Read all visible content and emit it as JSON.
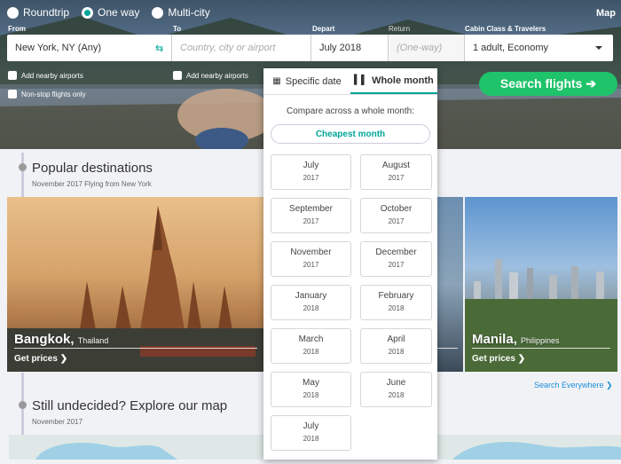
{
  "header": {
    "trip_types": [
      {
        "label": "Roundtrip",
        "selected": false
      },
      {
        "label": "One way",
        "selected": true
      },
      {
        "label": "Multi-city",
        "selected": false
      }
    ],
    "map_link": "Map",
    "labels": {
      "from": "From",
      "to": "To",
      "depart": "Depart",
      "return": "Return",
      "cabin": "Cabin Class & Travelers"
    },
    "from_value": "New York, NY (Any)",
    "to_placeholder": "Country, city or airport",
    "depart_value": "July 2018",
    "return_placeholder": "(One-way)",
    "cabin_value": "1 adult, Economy",
    "nearby_from": "Add nearby airports",
    "nearby_to": "Add nearby airports",
    "nonstop": "Non-stop flights only",
    "search_button": "Search flights ➔"
  },
  "popular": {
    "title": "Popular destinations",
    "subtitle": "November 2017    Flying from New York"
  },
  "cards": [
    {
      "city": "Bangkok",
      "country": "Thailand",
      "link": "Get prices ❯"
    },
    {
      "city": "",
      "country": "",
      "link": ""
    },
    {
      "city": "Manila",
      "country": "Philippines",
      "link": "Get prices ❯"
    }
  ],
  "search_everywhere": "Search Everywhere ❯",
  "undecided": {
    "title": "Still undecided? Explore our map",
    "subtitle": "November 2017"
  },
  "popup": {
    "tabs": [
      {
        "label": "Specific date",
        "active": false
      },
      {
        "label": "Whole month",
        "active": true
      }
    ],
    "compare_text": "Compare across a whole month:",
    "cheapest_button": "Cheapest month",
    "months": [
      {
        "month": "July",
        "year": "2017"
      },
      {
        "month": "August",
        "year": "2017"
      },
      {
        "month": "September",
        "year": "2017"
      },
      {
        "month": "October",
        "year": "2017"
      },
      {
        "month": "November",
        "year": "2017"
      },
      {
        "month": "December",
        "year": "2017"
      },
      {
        "month": "January",
        "year": "2018"
      },
      {
        "month": "February",
        "year": "2018"
      },
      {
        "month": "March",
        "year": "2018"
      },
      {
        "month": "April",
        "year": "2018"
      },
      {
        "month": "May",
        "year": "2018"
      },
      {
        "month": "June",
        "year": "2018"
      },
      {
        "month": "July",
        "year": "2018"
      }
    ]
  },
  "colors": {
    "accent": "#00a698",
    "search_green": "#1fc36a",
    "link_blue": "#1c8fd6"
  }
}
